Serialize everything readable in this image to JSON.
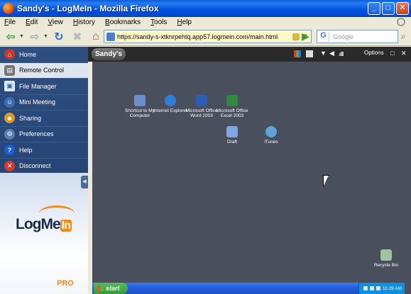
{
  "window": {
    "title": "Sandy's - LogMeIn - Mozilla Firefox",
    "buttons": {
      "minimize": "_",
      "maximize": "□",
      "close": "✕"
    }
  },
  "menubar": [
    "File",
    "Edit",
    "View",
    "History",
    "Bookmarks",
    "Tools",
    "Help"
  ],
  "navbar": {
    "url": "https://sandy-s-xtknrpehtq.app57.logmein.com/main.html",
    "search_placeholder": "Google",
    "search_engine_glyph": "G"
  },
  "sidebar": {
    "items": [
      {
        "label": "Home",
        "icon": "home-icon",
        "color": "#c0392b"
      },
      {
        "label": "Remote Control",
        "icon": "remote-control-icon",
        "color": "#555555",
        "active": true
      },
      {
        "label": "File Manager",
        "icon": "file-manager-icon",
        "color": "#1f5fbf"
      },
      {
        "label": "Mini Meeting",
        "icon": "mini-meeting-icon",
        "color": "#3a6db0"
      },
      {
        "label": "Sharing",
        "icon": "sharing-icon",
        "color": "#d99a2b"
      },
      {
        "label": "Preferences",
        "icon": "preferences-icon",
        "color": "#5b7fb0"
      },
      {
        "label": "Help",
        "icon": "help-icon",
        "color": "#1e5bd6"
      },
      {
        "label": "Disconnect",
        "icon": "disconnect-icon",
        "color": "#d23b2b"
      }
    ],
    "logo_text": "LogMe",
    "logo_in": "In",
    "logo_pro": "PRO"
  },
  "remote": {
    "tab_label": "Sandy's",
    "options_label": "Options"
  },
  "desktop_icons": [
    {
      "label": "Shortcut to My Computer",
      "icon": "my-computer-icon",
      "color": "#6d8fc9"
    },
    {
      "label": "Internet Explorer",
      "icon": "internet-explorer-icon",
      "color": "#2f7fd8"
    },
    {
      "label": "Microsoft Office Word 2003",
      "icon": "word-icon",
      "color": "#2b5fb5"
    },
    {
      "label": "Microsoft Office Excel 2003",
      "icon": "excel-icon",
      "color": "#2e8b3e"
    },
    {
      "label": "Draft",
      "icon": "document-icon",
      "color": "#7fa6e0"
    },
    {
      "label": "iTunes",
      "icon": "itunes-icon",
      "color": "#5fa3d6"
    },
    {
      "label": "Recycle Bin",
      "icon": "recycle-bin-icon",
      "color": "#9ec4a0"
    }
  ],
  "taskbar": {
    "start_label": "start",
    "clock": "11:29 AM"
  }
}
